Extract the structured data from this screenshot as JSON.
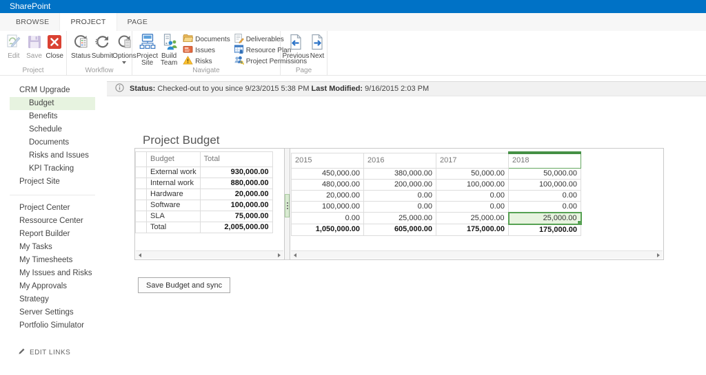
{
  "suite_bar": {
    "brand": "SharePoint"
  },
  "tabs": {
    "items": [
      {
        "label": "BROWSE",
        "active": false
      },
      {
        "label": "PROJECT",
        "active": true
      },
      {
        "label": "PAGE",
        "active": false
      }
    ]
  },
  "ribbon": {
    "groups": [
      {
        "label": "Project"
      },
      {
        "label": "Workflow"
      },
      {
        "label": "Navigate"
      },
      {
        "label": "Page"
      }
    ],
    "buttons": {
      "edit": "Edit",
      "save": "Save",
      "close": "Close",
      "status": "Status",
      "submit": "Submit",
      "options": "Options",
      "project_site": "Project Site",
      "build_team": "Build Team",
      "documents": "Documents",
      "issues": "Issues",
      "risks": "Risks",
      "deliverables": "Deliverables",
      "resource_plan": "Resource Plan",
      "project_permissions": "Project Permissions",
      "previous": "Previous",
      "next": "Next"
    }
  },
  "status_bar": {
    "status_label": "Status:",
    "status_value": "Checked-out to you since 9/23/2015 5:38 PM",
    "modified_label": "Last Modified:",
    "modified_value": "9/16/2015 2:03 PM"
  },
  "sidebar": {
    "sections": [
      {
        "items": [
          {
            "label": "CRM Upgrade",
            "level": 1
          },
          {
            "label": "Budget",
            "level": 2,
            "selected": true
          },
          {
            "label": "Benefits",
            "level": 2
          },
          {
            "label": "Schedule",
            "level": 2
          },
          {
            "label": "Documents",
            "level": 2
          },
          {
            "label": "Risks and Issues",
            "level": 2
          },
          {
            "label": "KPI Tracking",
            "level": 2
          },
          {
            "label": "Project Site",
            "level": 1
          }
        ]
      },
      {
        "items": [
          {
            "label": "Project Center",
            "level": 1
          },
          {
            "label": "Ressource Center",
            "level": 1
          },
          {
            "label": "Report Builder",
            "level": 1
          },
          {
            "label": "My Tasks",
            "level": 1
          },
          {
            "label": "My Timesheets",
            "level": 1
          },
          {
            "label": "My Issues and Risks",
            "level": 1
          },
          {
            "label": "My Approvals",
            "level": 1
          },
          {
            "label": "Strategy",
            "level": 1
          },
          {
            "label": "Server Settings",
            "level": 1
          },
          {
            "label": "Portfolio Simulator",
            "level": 1
          }
        ]
      }
    ],
    "edit_links": "EDIT LINKS"
  },
  "main": {
    "title": "Project Budget",
    "save_button": "Save Budget and sync",
    "budget_table": {
      "row_header": "Budget",
      "total_header": "Total",
      "years": [
        "2015",
        "2016",
        "2017",
        "2018"
      ],
      "selected_year": "2018",
      "selected_cell": {
        "row": "SLA",
        "year": "2018"
      },
      "rows": [
        {
          "label": "External work",
          "total": "930,000.00",
          "values": [
            "450,000.00",
            "380,000.00",
            "50,000.00",
            "50,000.00"
          ]
        },
        {
          "label": "Internal work",
          "total": "880,000.00",
          "values": [
            "480,000.00",
            "200,000.00",
            "100,000.00",
            "100,000.00"
          ]
        },
        {
          "label": "Hardware",
          "total": "20,000.00",
          "values": [
            "20,000.00",
            "0.00",
            "0.00",
            "0.00"
          ]
        },
        {
          "label": "Software",
          "total": "100,000.00",
          "values": [
            "100,000.00",
            "0.00",
            "0.00",
            "0.00"
          ]
        },
        {
          "label": "SLA",
          "total": "75,000.00",
          "values": [
            "0.00",
            "25,000.00",
            "25,000.00",
            "25,000.00"
          ]
        },
        {
          "label": "Total",
          "total": "2,005,000.00",
          "values": [
            "1,050,000.00",
            "605,000.00",
            "175,000.00",
            "175,000.00"
          ],
          "is_total": true
        }
      ]
    }
  },
  "colors": {
    "accent_blue": "#0072c6",
    "selection_green": "#56a152",
    "selection_fill": "#e7f3df",
    "close_red": "#da4132",
    "nav_highlight": "#e7f3e0"
  }
}
